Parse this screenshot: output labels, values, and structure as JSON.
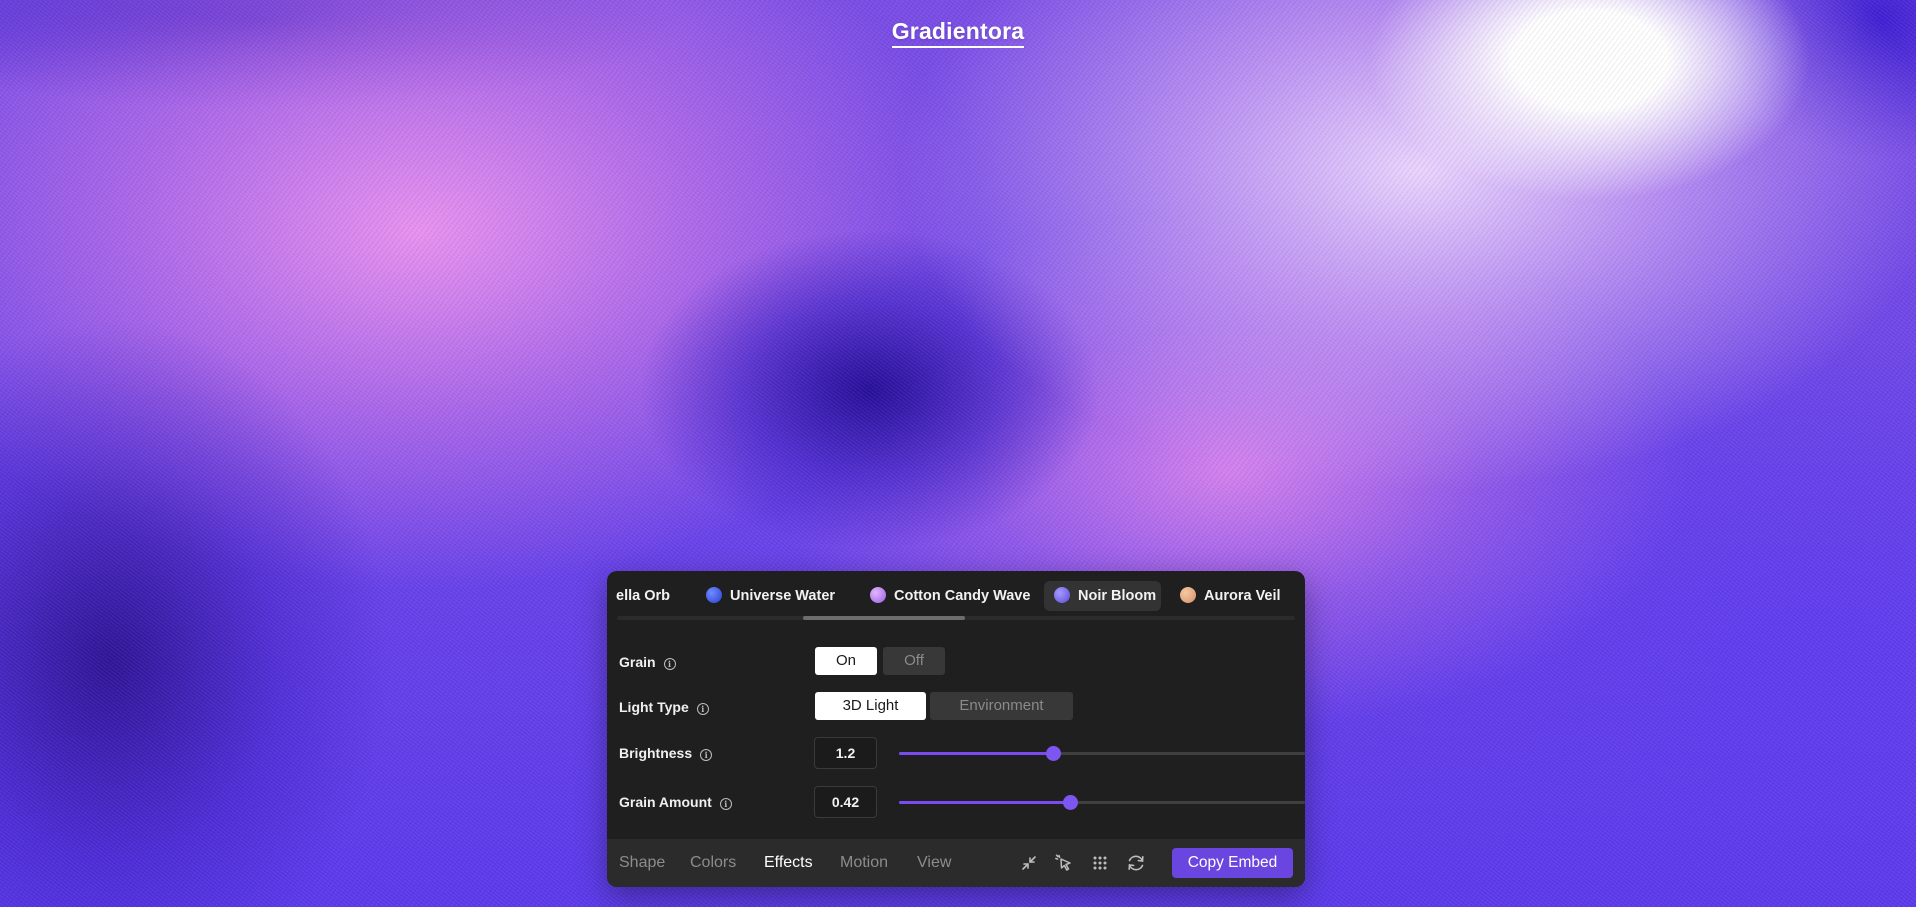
{
  "brand": {
    "title": "Gradientora"
  },
  "presets": [
    {
      "label": "ella Orb",
      "dot_color": ""
    },
    {
      "label": "Universe Water",
      "dot_color": "#3f5fe0"
    },
    {
      "label": "Cotton Candy Wave",
      "dot_color": "#b77ee8"
    },
    {
      "label": "Noir Bloom",
      "dot_color": "#7a6be8",
      "active": true
    },
    {
      "label": "Aurora Veil",
      "dot_color": "#e3a98a"
    }
  ],
  "scroll": {
    "position": 0.36
  },
  "controls": {
    "grain": {
      "label": "Grain",
      "options": [
        "On",
        "Off"
      ],
      "selected": "On"
    },
    "light_type": {
      "label": "Light Type",
      "options": [
        "3D Light",
        "Environment"
      ],
      "selected": "3D Light"
    },
    "brightness": {
      "label": "Brightness",
      "value": "1.2",
      "fraction": 0.38
    },
    "grain_amount": {
      "label": "Grain Amount",
      "value": "0.42",
      "fraction": 0.42
    }
  },
  "tabs": [
    {
      "label": "Shape"
    },
    {
      "label": "Colors"
    },
    {
      "label": "Effects",
      "active": true
    },
    {
      "label": "Motion"
    },
    {
      "label": "View"
    }
  ],
  "tools": [
    "collapse-icon",
    "pointer-click-icon",
    "grid-icon",
    "refresh-icon"
  ],
  "actions": {
    "copy_embed": "Copy Embed"
  },
  "colors": {
    "accent": "#6a45e0",
    "panel": "#1f1f1f",
    "slider": "#7a4cf0"
  }
}
